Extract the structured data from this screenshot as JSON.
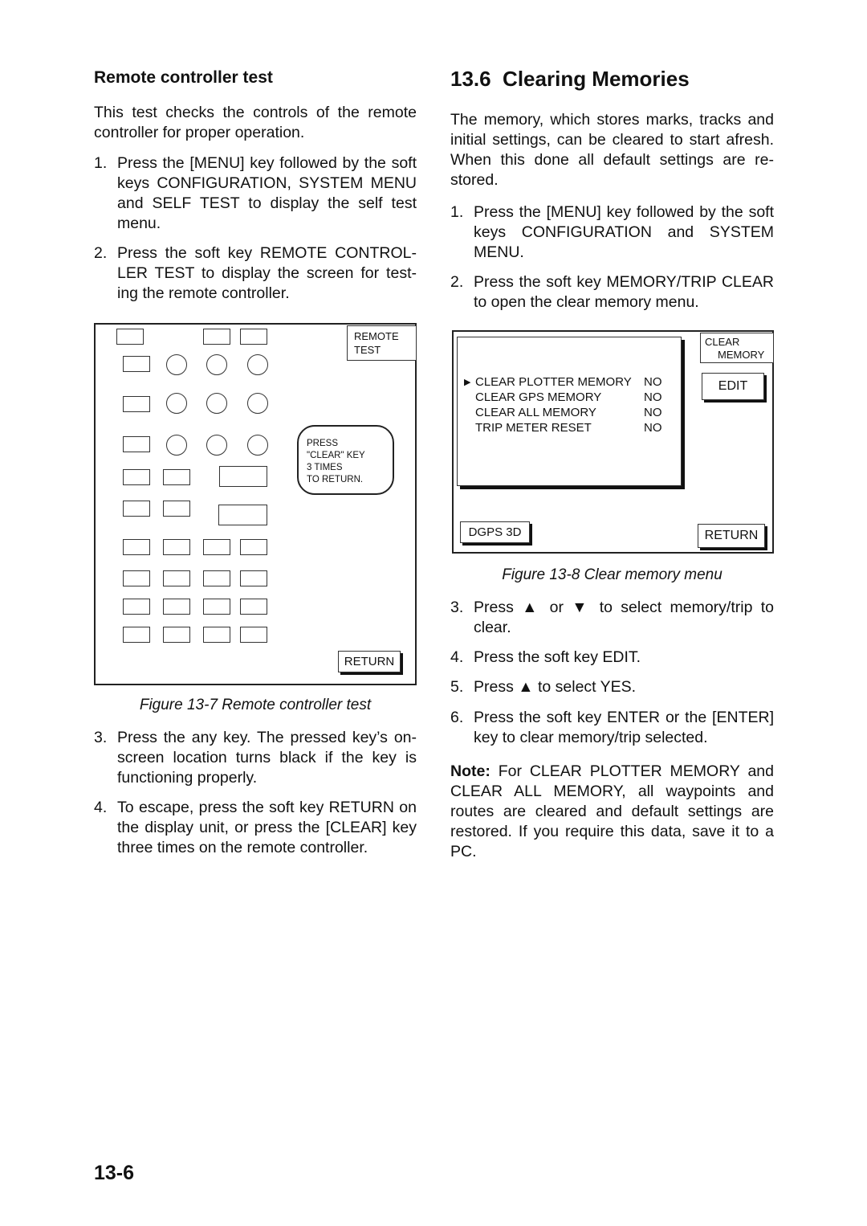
{
  "left_column": {
    "heading": "Remote controller test",
    "intro": "This test checks the controls of the remote controller for proper operation.",
    "steps_before": [
      {
        "num": "1.",
        "text": "Press the [MENU] key followed by the soft keys CONFIGURATION, SYSTEM MENU and SELF TEST to display the self test menu."
      },
      {
        "num": "2.",
        "text": "Press the soft key REMOTE CONTROL-LER TEST to display the screen for test-ing the remote controller."
      }
    ],
    "figure": {
      "soft_label": [
        "REMOTE",
        "TEST"
      ],
      "bubble_lines": [
        "PRESS",
        "\"CLEAR\" KEY",
        "3 TIMES",
        "TO RETURN."
      ],
      "return_button": "RETURN",
      "caption": "Figure 13-7  Remote controller test"
    },
    "steps_after": [
      {
        "num": "3.",
        "text": "Press the any key. The pressed key’s on-screen location turns black if the key is functioning properly."
      },
      {
        "num": "4.",
        "text": "To escape, press the soft key RETURN on the display unit, or press the [CLEAR] key three times on the remote controller."
      }
    ]
  },
  "right_column": {
    "heading": "13.6  Clearing Memories",
    "intro": "The memory, which stores marks, tracks and initial settings, can be cleared to start afresh. When this done all default settings are re-stored.",
    "steps_before": [
      {
        "num": "1.",
        "text": "Press the [MENU] key followed by the soft keys CONFIGURATION and SYSTEM MENU."
      },
      {
        "num": "2.",
        "text": "Press the soft key MEMORY/TRIP CLEAR to open the clear memory menu."
      }
    ],
    "figure": {
      "soft_label": [
        "CLEAR",
        "MEMORY"
      ],
      "cursor": "▶",
      "menu_items": [
        {
          "label": "CLEAR PLOTTER MEMORY",
          "value": "NO"
        },
        {
          "label": "CLEAR GPS MEMORY",
          "value": "NO"
        },
        {
          "label": "CLEAR ALL MEMORY",
          "value": "NO"
        },
        {
          "label": "TRIP METER RESET",
          "value": "NO"
        }
      ],
      "edit_button": "EDIT",
      "status": "DGPS 3D",
      "return_button": "RETURN",
      "caption": "Figure 13-8 Clear memory menu"
    },
    "steps_after": [
      {
        "num": "3.",
        "text": "Press ▲ or ▼ to select memory/trip to clear."
      },
      {
        "num": "4.",
        "text": "Press the soft key EDIT."
      },
      {
        "num": "5.",
        "text": "Press ▲ to select YES."
      },
      {
        "num": "6.",
        "text": "Press the soft key ENTER or the [ENTER] key to clear memory/trip selected."
      }
    ],
    "note_label": "Note:",
    "note_text": " For CLEAR PLOTTER MEMORY and CLEAR ALL MEMORY, all waypoints and routes are cleared and default settings are restored. If you require this data, save it to a PC."
  },
  "page_number": "13-6"
}
